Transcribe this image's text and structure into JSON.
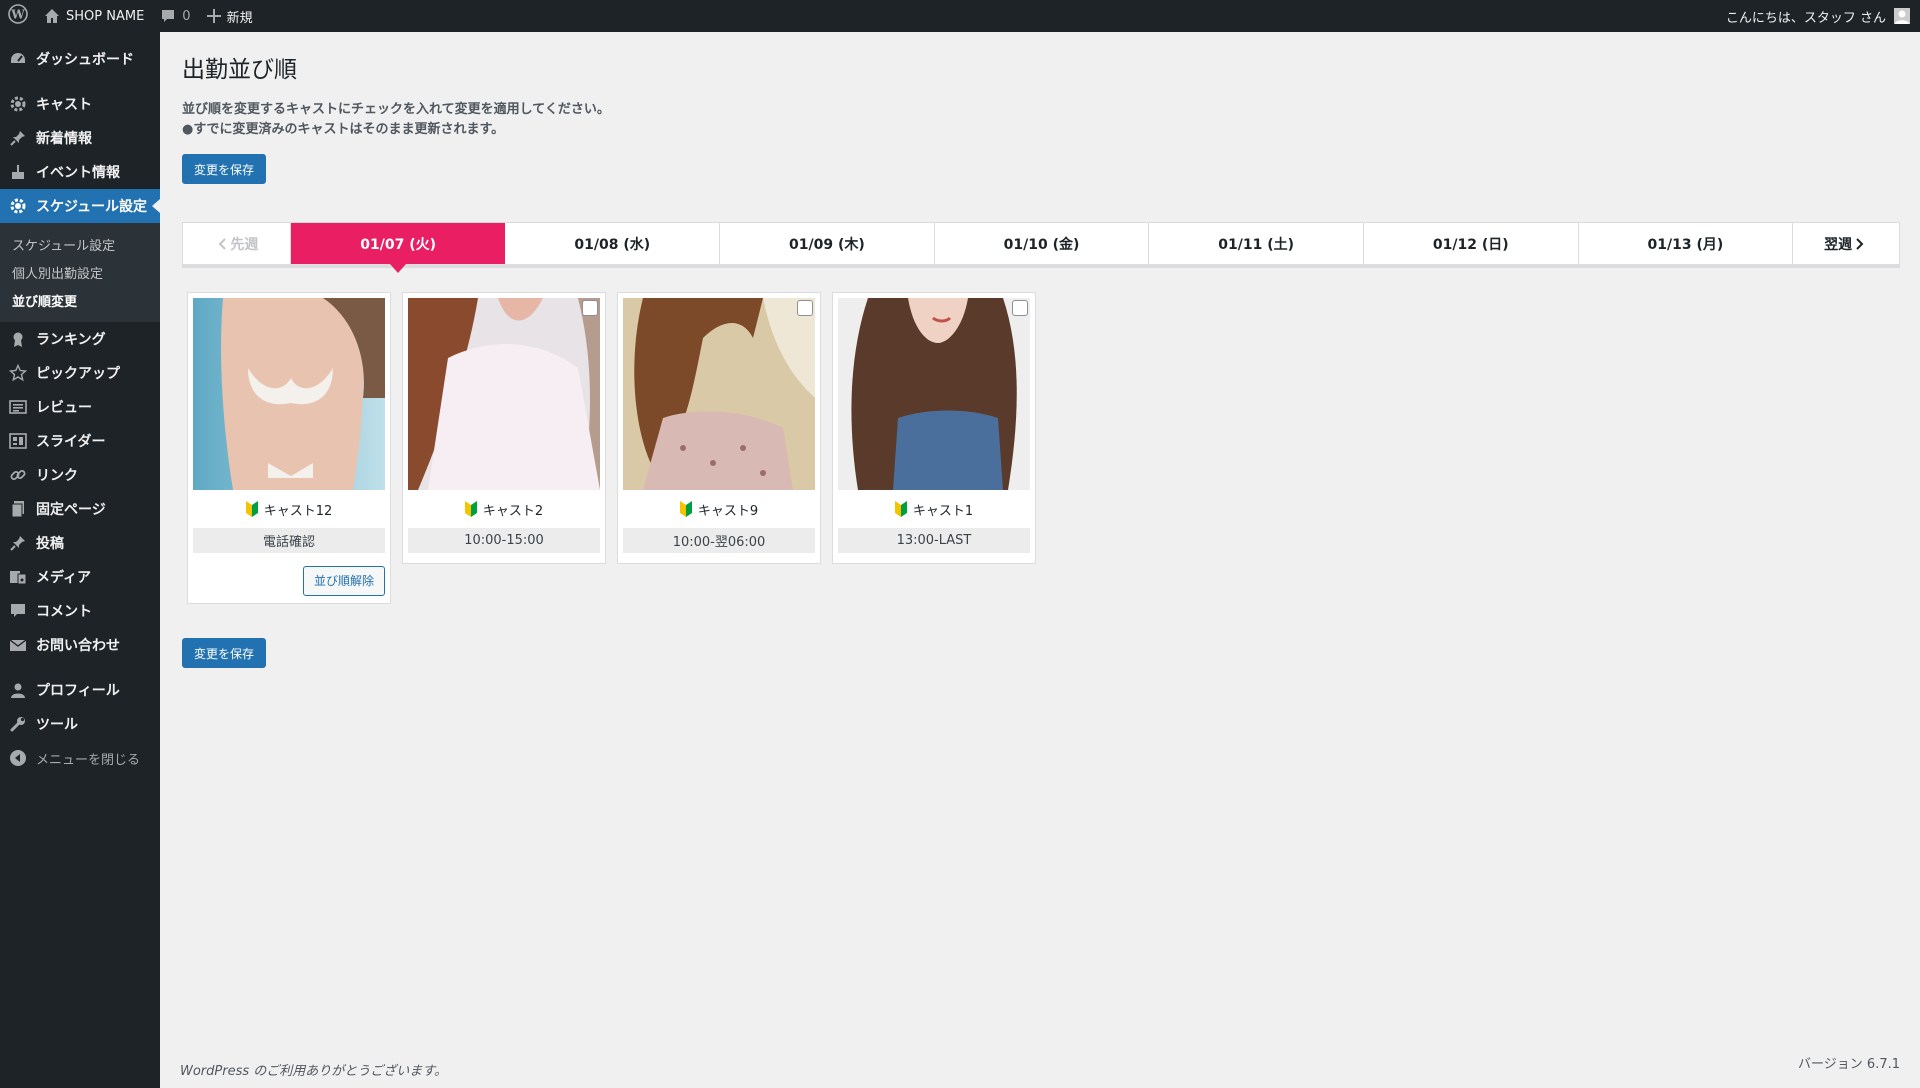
{
  "adminbar": {
    "site_name": "SHOP NAME",
    "comments_count": "0",
    "new_label": "新規",
    "greeting": "こんにちは、スタッフ さん"
  },
  "sidebar": {
    "items": [
      {
        "label": "ダッシュボード",
        "icon": "dashboard-icon"
      },
      {
        "label": "キャスト",
        "icon": "gear-icon"
      },
      {
        "label": "新着情報",
        "icon": "pin-icon"
      },
      {
        "label": "イベント情報",
        "icon": "cake-icon"
      },
      {
        "label": "スケジュール設定",
        "icon": "gear-icon"
      },
      {
        "label": "ランキング",
        "icon": "award-icon"
      },
      {
        "label": "ピックアップ",
        "icon": "star-icon"
      },
      {
        "label": "レビュー",
        "icon": "list-icon"
      },
      {
        "label": "スライダー",
        "icon": "slides-icon"
      },
      {
        "label": "リンク",
        "icon": "link-icon"
      },
      {
        "label": "固定ページ",
        "icon": "page-icon"
      },
      {
        "label": "投稿",
        "icon": "pin-icon"
      },
      {
        "label": "メディア",
        "icon": "media-icon"
      },
      {
        "label": "コメント",
        "icon": "comment-icon"
      },
      {
        "label": "お問い合わせ",
        "icon": "mail-icon"
      },
      {
        "label": "プロフィール",
        "icon": "user-icon"
      },
      {
        "label": "ツール",
        "icon": "wrench-icon"
      }
    ],
    "submenu": [
      "スケジュール設定",
      "個人別出勤設定",
      "並び順変更"
    ],
    "collapse_label": "メニューを閉じる"
  },
  "page": {
    "title": "出勤並び順",
    "desc_line1": "並び順を変更するキャストにチェックを入れて変更を適用してください。",
    "desc_line2": "●すでに変更済みのキャストはそのまま更新されます。",
    "save_label": "変更を保存"
  },
  "tabs": {
    "prev_label": "先週",
    "days": [
      "01/07 (火)",
      "01/08 (水)",
      "01/09 (木)",
      "01/10 (金)",
      "01/11 (土)",
      "01/12 (日)",
      "01/13 (月)"
    ],
    "active_index": 0,
    "next_label": "翌週"
  },
  "casts": [
    {
      "name": "キャスト12",
      "time": "電話確認",
      "locked": true
    },
    {
      "name": "キャスト2",
      "time": "10:00-15:00",
      "locked": false
    },
    {
      "name": "キャスト9",
      "time": "10:00-翌06:00",
      "locked": false
    },
    {
      "name": "キャスト1",
      "time": "13:00-LAST",
      "locked": false
    }
  ],
  "unlock_label": "並び順解除",
  "footer": {
    "thanks": "WordPress のご利用ありがとうございます。",
    "version": "バージョン 6.7.1"
  },
  "colors": {
    "accent": "#2271b1",
    "active_tab": "#e91e63",
    "sidebar_bg": "#1d2327"
  }
}
